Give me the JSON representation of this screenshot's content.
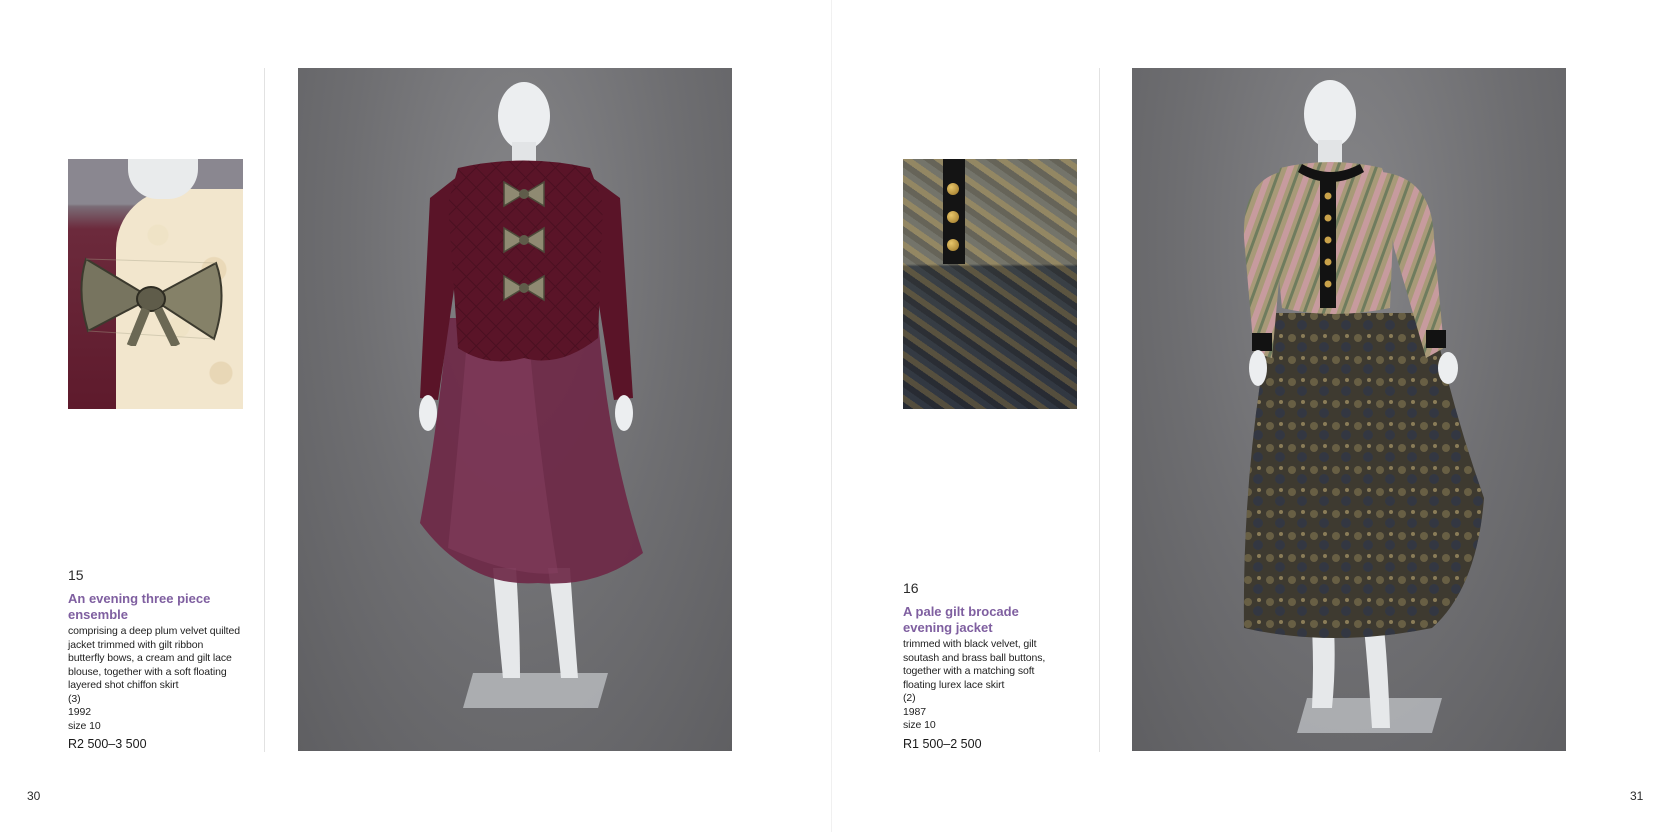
{
  "pages": {
    "left": {
      "folio": "30",
      "lot": {
        "number": "15",
        "title_lines": [
          "An evening three piece",
          "ensemble"
        ],
        "description_lines": [
          "comprising a deep plum velvet quilted",
          "jacket trimmed with gilt ribbon",
          "butterfly bows, a cream and gilt lace",
          "blouse, together with a soft floating",
          "layered shot chiffon skirt",
          "(3)",
          "1992",
          "size 10"
        ],
        "estimate": "R2 500–3 500"
      },
      "colors": {
        "jacket": "#5a1428",
        "skirt": "#6e2846",
        "bows": "#8f8a72"
      }
    },
    "right": {
      "folio": "31",
      "lot": {
        "number": "16",
        "title_lines": [
          "A pale gilt brocade",
          "evening jacket"
        ],
        "description_lines": [
          "trimmed with black velvet, gilt",
          "soutash and brass ball buttons,",
          "together with a matching soft",
          "floating lurex lace skirt",
          "(2)",
          "1987",
          "size 10"
        ],
        "estimate": "R1 500–2 500"
      },
      "colors": {
        "jacket": "#a89a78",
        "velvet": "#121212",
        "skirt": "#3e3a30"
      }
    }
  },
  "accent": "#7f5fa0"
}
